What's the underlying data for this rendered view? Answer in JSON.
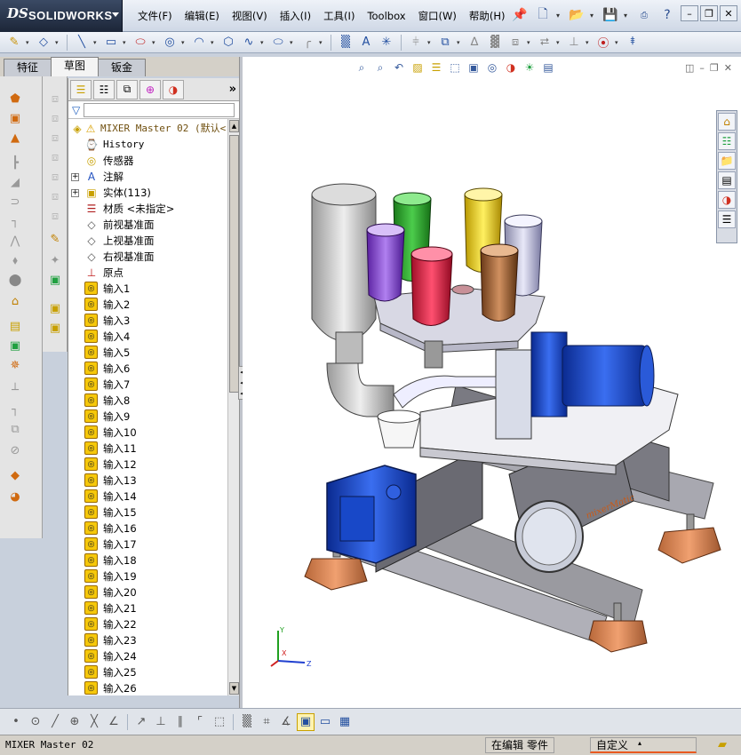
{
  "app": {
    "brand_prefix": "DS",
    "brand_name": "SOLIDWORKS"
  },
  "menu": [
    "文件(F)",
    "编辑(E)",
    "视图(V)",
    "插入(I)",
    "工具(I)",
    "Toolbox",
    "窗口(W)",
    "帮助(H)"
  ],
  "quick_access": [
    "pin-icon",
    "new-document-icon",
    "open-icon",
    "save-icon",
    "print-icon",
    "help-icon"
  ],
  "sketch_toolbar": [
    "smart-dimension-icon",
    "line-icon",
    "rectangle-icon",
    "slot-icon",
    "circle-icon",
    "arc-icon",
    "polygon-icon",
    "spline-icon",
    "ellipse-icon",
    "fillet-icon",
    "text-icon",
    "point-icon",
    "mirror-icon",
    "offset-icon",
    "trim-icon",
    "pattern-icon",
    "move-icon",
    "relations-icon",
    "repair-icon",
    "quick-snaps-icon"
  ],
  "tabs": [
    "特征",
    "草图",
    "钣金"
  ],
  "active_tab": 1,
  "tree": {
    "root": "MIXER Master 02  (默认<",
    "items": [
      {
        "label": "History",
        "icon": "history-icon",
        "mono": true
      },
      {
        "label": "传感器",
        "icon": "sensor-icon"
      },
      {
        "label": "注解",
        "icon": "annotation-icon",
        "expand": true
      },
      {
        "label": "实体(113)",
        "icon": "solid-bodies-icon",
        "expand": true
      },
      {
        "label": "材质 <未指定>",
        "icon": "material-icon"
      },
      {
        "label": "前视基准面",
        "icon": "plane-icon"
      },
      {
        "label": "上视基准面",
        "icon": "plane-icon"
      },
      {
        "label": "右视基准面",
        "icon": "plane-icon"
      },
      {
        "label": "原点",
        "icon": "origin-icon"
      },
      {
        "label": "输入1",
        "icon": "imported-body-icon"
      },
      {
        "label": "输入2",
        "icon": "imported-body-icon"
      },
      {
        "label": "输入3",
        "icon": "imported-body-icon"
      },
      {
        "label": "输入4",
        "icon": "imported-body-icon"
      },
      {
        "label": "输入5",
        "icon": "imported-body-icon"
      },
      {
        "label": "输入6",
        "icon": "imported-body-icon"
      },
      {
        "label": "输入7",
        "icon": "imported-body-icon"
      },
      {
        "label": "输入8",
        "icon": "imported-body-icon"
      },
      {
        "label": "输入9",
        "icon": "imported-body-icon"
      },
      {
        "label": "输入10",
        "icon": "imported-body-icon"
      },
      {
        "label": "输入11",
        "icon": "imported-body-icon"
      },
      {
        "label": "输入12",
        "icon": "imported-body-icon"
      },
      {
        "label": "输入13",
        "icon": "imported-body-icon"
      },
      {
        "label": "输入14",
        "icon": "imported-body-icon"
      },
      {
        "label": "输入15",
        "icon": "imported-body-icon"
      },
      {
        "label": "输入16",
        "icon": "imported-body-icon"
      },
      {
        "label": "输入17",
        "icon": "imported-body-icon"
      },
      {
        "label": "输入18",
        "icon": "imported-body-icon"
      },
      {
        "label": "输入19",
        "icon": "imported-body-icon"
      },
      {
        "label": "输入20",
        "icon": "imported-body-icon"
      },
      {
        "label": "输入21",
        "icon": "imported-body-icon"
      },
      {
        "label": "输入22",
        "icon": "imported-body-icon"
      },
      {
        "label": "输入23",
        "icon": "imported-body-icon"
      },
      {
        "label": "输入24",
        "icon": "imported-body-icon"
      },
      {
        "label": "输入25",
        "icon": "imported-body-icon"
      },
      {
        "label": "输入26",
        "icon": "imported-body-icon"
      }
    ]
  },
  "viewport": {
    "model": "MIXER Master 02",
    "triad": {
      "x": "X",
      "y": "Y",
      "z": "Z"
    },
    "brand_decal": "mixerMatic"
  },
  "status": {
    "doc": "MIXER Master 02",
    "editing": "在编辑 零件",
    "units": "自定义"
  },
  "colors": {
    "cup_green": "#2e9e2e",
    "cup_yellow": "#e8c81e",
    "cup_purple": "#7a3cc8",
    "cup_red": "#d8203c",
    "cup_brown": "#9a5a30",
    "cup_lilac": "#b8b8d0",
    "motor_blue": "#1e4ed8"
  }
}
